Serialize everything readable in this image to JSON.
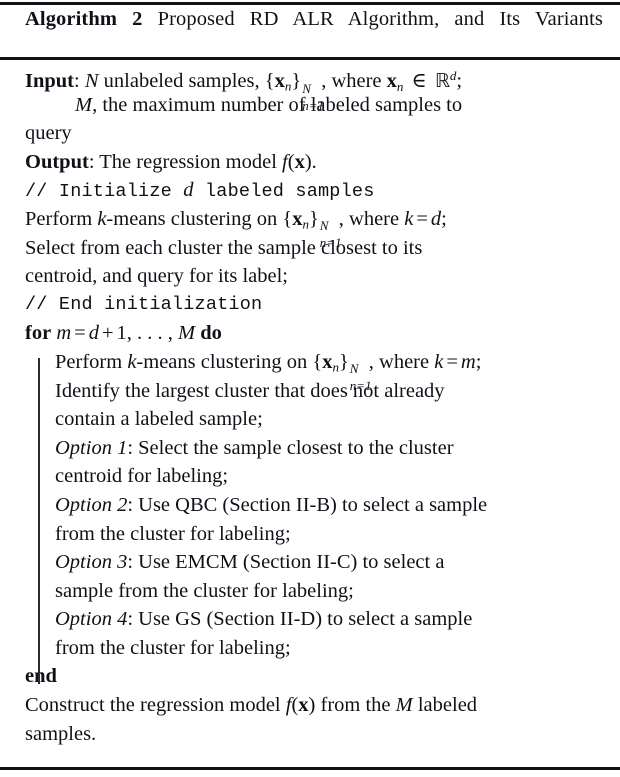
{
  "algorithm": {
    "label": "Algorithm",
    "number": "2",
    "title": "Proposed RD ALR Algorithm, and Its Variants",
    "title_words": [
      "Proposed",
      "RD",
      "ALR",
      "Algorithm,",
      "and",
      "Its",
      "Variants"
    ],
    "input_label": "Input",
    "output_label": "Output",
    "for_keyword": "for",
    "do_keyword": "do",
    "end_keyword": "end"
  },
  "lines": [
    {
      "id": "input-line-1",
      "kind": "input",
      "text": "Input: N unlabeled samples, {x_n}^N_{n=1}, where x_n ∈ R^d;",
      "parts": {
        "label": "Input",
        "colon": ":",
        "N": "N",
        "t1": "unlabeled samples,",
        "brace_open": "{",
        "x": "x",
        "n": "n",
        "brace_close": "}",
        "sup_N": "N",
        "sub_n1": "n=1",
        "comma": ",",
        "t2": "where",
        "in": "∈",
        "R": "ℝ",
        "d": "d",
        "semi": ";"
      }
    },
    {
      "id": "input-line-2",
      "kind": "input-cont",
      "text": "M, the maximum number of labeled samples to",
      "parts": {
        "M": "M",
        "rest": ", the maximum number of labeled samples to"
      }
    },
    {
      "id": "input-line-3",
      "kind": "input-cont-flush",
      "text": "query"
    },
    {
      "id": "output-line",
      "kind": "output",
      "text": "Output: The regression model f(x).",
      "parts": {
        "label": "Output",
        "colon": ":",
        "t1": "The regression model",
        "f": "f",
        "paren_open": "(",
        "x": "x",
        "paren_close": ")",
        "period": "."
      }
    },
    {
      "id": "comment-init",
      "kind": "comment",
      "text": "// Initialize d labeled samples",
      "parts": {
        "pre": "// Initialize ",
        "var": "d",
        "post": " labeled samples"
      }
    },
    {
      "id": "stmt-kmeans-d",
      "kind": "stmt",
      "text": "Perform k-means clustering on {x_n}^N_{n=1}, where k = d;",
      "parts": {
        "t1": "Perform",
        "k": "k",
        "t2": "-means clustering on",
        "brace_open": "{",
        "x": "x",
        "n": "n",
        "brace_close": "}",
        "sup_N": "N",
        "sub_n1": "n=1",
        "comma": ",",
        "t3": "where",
        "k2": "k",
        "eq": "=",
        "d": "d",
        "semi": ";"
      }
    },
    {
      "id": "stmt-select-closest",
      "kind": "stmt",
      "text": "Select from each cluster the sample closest to its"
    },
    {
      "id": "stmt-centroid-query",
      "kind": "stmt",
      "text": "centroid, and query for its label;"
    },
    {
      "id": "comment-end-init",
      "kind": "comment",
      "text": "// End initialization",
      "parts": {
        "pre": "// End initialization",
        "var": "",
        "post": ""
      }
    },
    {
      "id": "for-line",
      "kind": "for",
      "text": "for m = d + 1, …, M do",
      "parts": {
        "for": "for",
        "m": "m",
        "eq": "=",
        "d": "d",
        "plus": "+",
        "one": "1",
        "dots": ", . . . ,",
        "M": "M",
        "do": "do"
      }
    },
    {
      "id": "loop-kmeans-m",
      "kind": "loop-stmt",
      "text": "Perform k-means clustering on {x_n}^N_{n=1}, where k = m;",
      "parts": {
        "t1": "Perform",
        "k": "k",
        "t2": "-means clustering on",
        "brace_open": "{",
        "x": "x",
        "n": "n",
        "brace_close": "}",
        "sup_N": "N",
        "sub_n1": "n=1",
        "comma": ",",
        "t3": "where",
        "k2": "k",
        "eq": "=",
        "m": "m",
        "semi": ";"
      }
    },
    {
      "id": "loop-identify-1",
      "kind": "loop-stmt",
      "text": "Identify the largest cluster that does not already"
    },
    {
      "id": "loop-identify-2",
      "kind": "loop-stmt",
      "text": "contain a labeled sample;"
    },
    {
      "id": "option-1-a",
      "kind": "loop-option",
      "parts": {
        "option": "Option 1",
        "rest": ": Select the sample closest to the cluster"
      }
    },
    {
      "id": "option-1-b",
      "kind": "loop-stmt",
      "text": "centroid for labeling;"
    },
    {
      "id": "option-2-a",
      "kind": "loop-option",
      "parts": {
        "option": "Option 2",
        "rest": ": Use QBC (Section II-B) to select a sample"
      }
    },
    {
      "id": "option-2-b",
      "kind": "loop-stmt",
      "text": "from the cluster for labeling;"
    },
    {
      "id": "option-3-a",
      "kind": "loop-option",
      "parts": {
        "option": "Option 3",
        "rest": ": Use EMCM (Section II-C) to select a"
      }
    },
    {
      "id": "option-3-b",
      "kind": "loop-stmt",
      "text": "sample from the cluster for labeling;"
    },
    {
      "id": "option-4-a",
      "kind": "loop-option",
      "parts": {
        "option": "Option 4",
        "rest": ": Use GS (Section II-D) to select a sample"
      }
    },
    {
      "id": "option-4-b",
      "kind": "loop-stmt",
      "text": "from the cluster for labeling;"
    },
    {
      "id": "end-line",
      "kind": "end",
      "text": "end"
    },
    {
      "id": "final-line-1",
      "kind": "stmt",
      "text": "Construct the regression model f(x) from the M labeled",
      "parts": {
        "t1": "Construct the regression model",
        "f": "f",
        "paren_open": "(",
        "x": "x",
        "paren_close": ")",
        "t2": "from the",
        "M": "M",
        "t3": "labeled"
      }
    },
    {
      "id": "final-line-2",
      "kind": "stmt",
      "text": "samples."
    }
  ],
  "colors": {
    "text": "#111018",
    "rule": "#141018",
    "loop_bar": "#2c2a33",
    "background": "#ffffff"
  }
}
